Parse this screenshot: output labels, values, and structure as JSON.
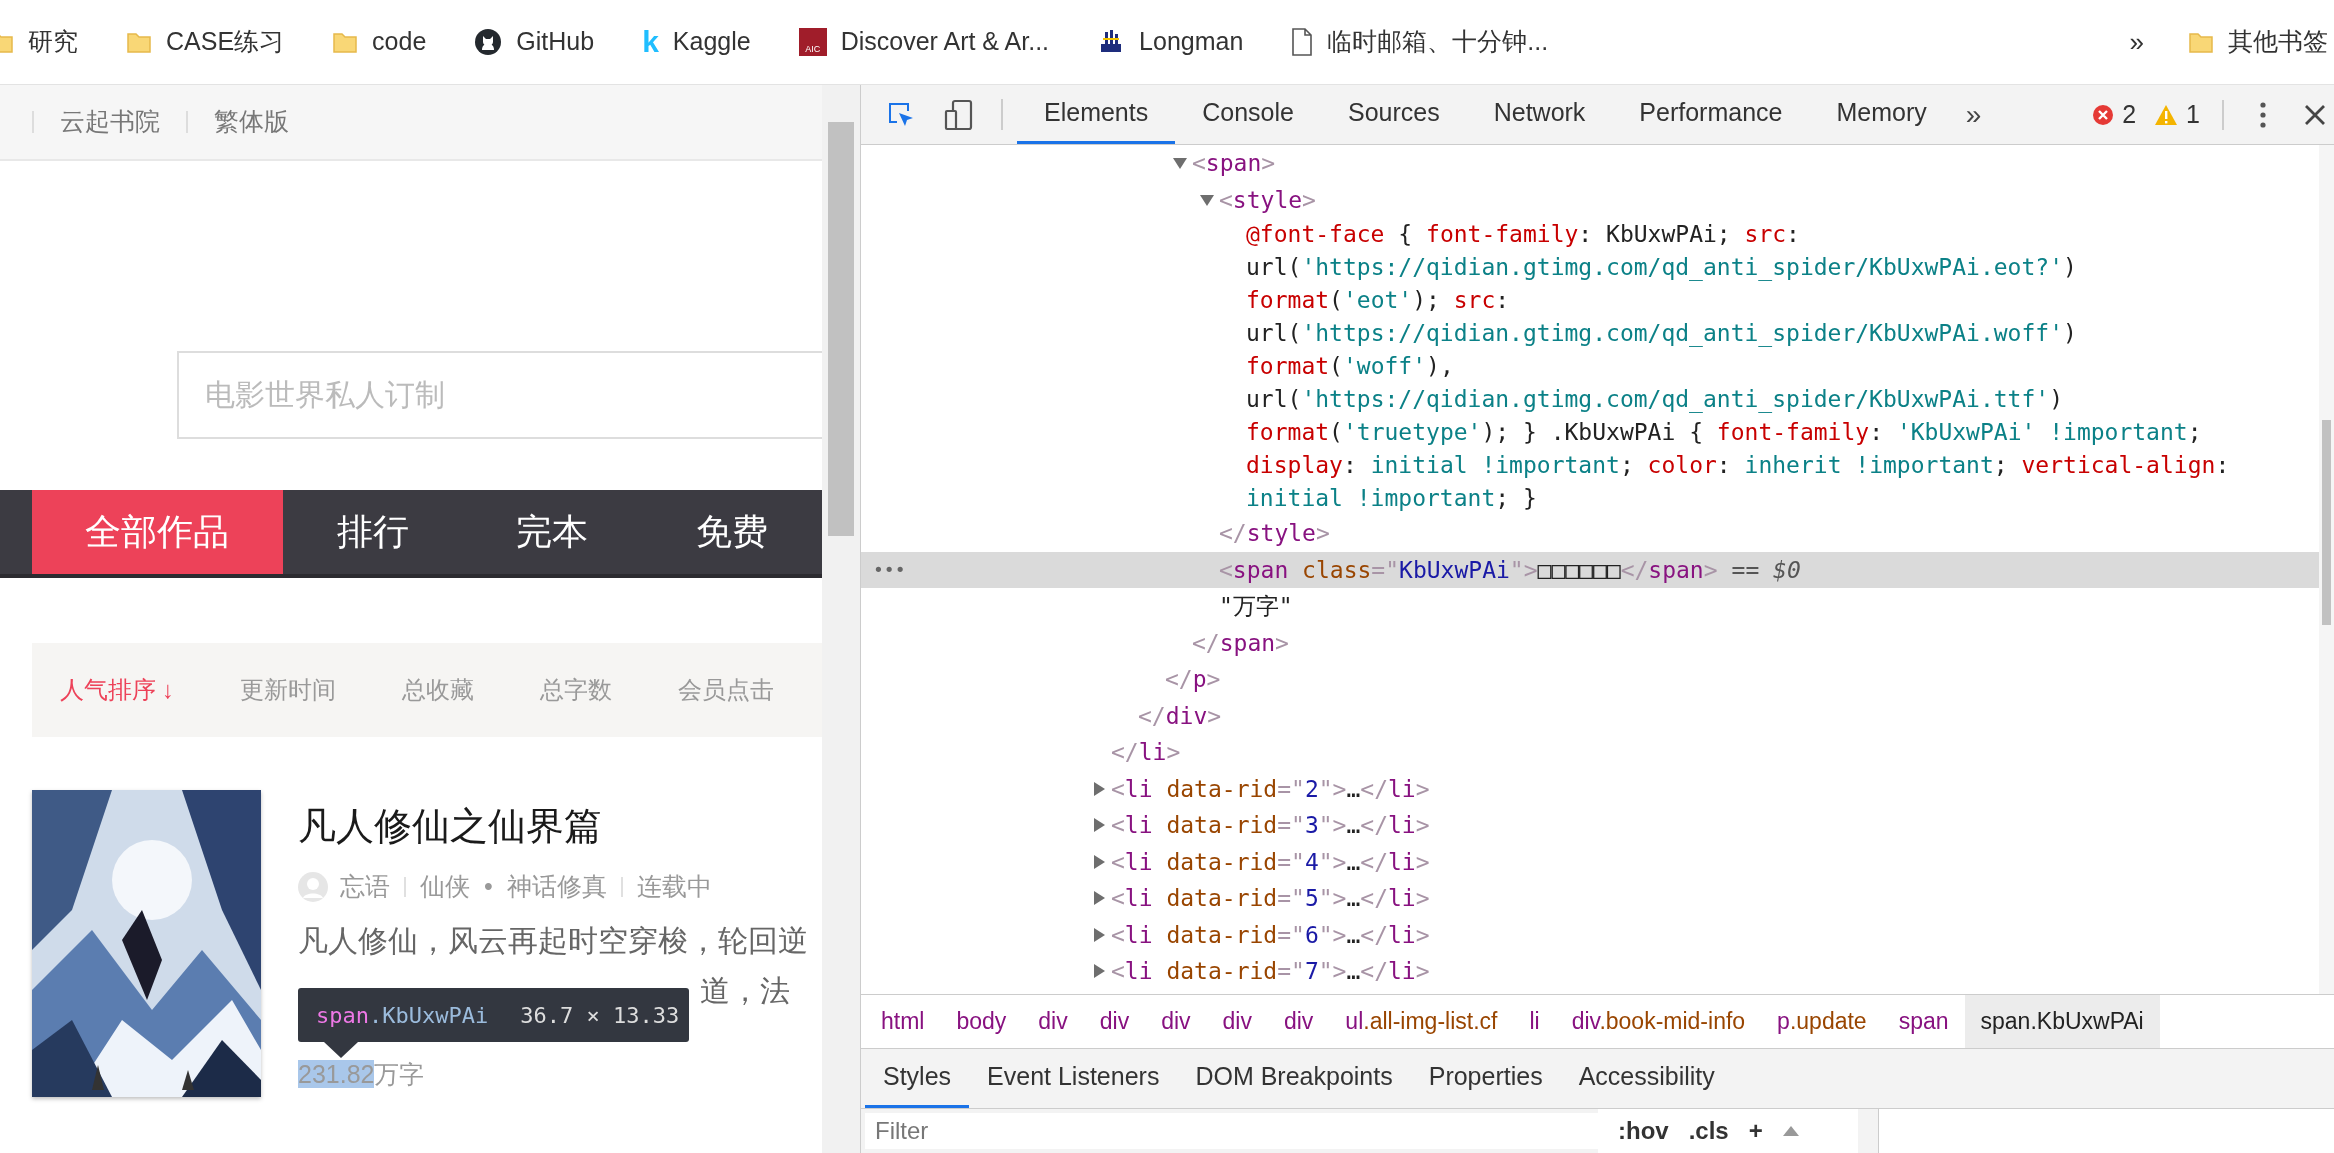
{
  "bookmarks": [
    {
      "kind": "folder",
      "label": "研究"
    },
    {
      "kind": "folder",
      "label": "CASE练习"
    },
    {
      "kind": "folder",
      "label": "code"
    },
    {
      "kind": "cat",
      "label": "GitHub"
    },
    {
      "kind": "letter",
      "glyph": "k",
      "label": "Kaggle"
    },
    {
      "kind": "badge",
      "glyph": "AIC",
      "label": "Discover Art & Ar..."
    },
    {
      "kind": "ship",
      "label": "Longman"
    },
    {
      "kind": "page",
      "label": "临时邮箱、十分钟..."
    }
  ],
  "bookmarks_overflow": "»",
  "other_bookmarks": {
    "kind": "folder",
    "label": "其他书签"
  },
  "site": {
    "top_links": [
      "云起书院",
      "繁体版"
    ],
    "search": {
      "placeholder": "电影世界私人订制"
    },
    "nav_tabs": [
      {
        "label": "全部作品",
        "selected": true
      },
      {
        "label": "排行",
        "selected": false
      },
      {
        "label": "完本",
        "selected": false
      },
      {
        "label": "免费",
        "selected": false
      }
    ],
    "sort_options": [
      {
        "label": "人气排序",
        "arrow": "↓",
        "selected": true
      },
      {
        "label": "更新时间",
        "selected": false
      },
      {
        "label": "总收藏",
        "selected": false
      },
      {
        "label": "总字数",
        "selected": false
      },
      {
        "label": "会员点击",
        "selected": false
      }
    ],
    "book": {
      "cover": {
        "kind": "picture"
      },
      "title": "凡人修仙之仙界篇",
      "meta_groups": [
        [
          "忘语"
        ],
        [
          "仙侠",
          "•",
          "神话修真"
        ],
        [
          "连载中"
        ]
      ],
      "intro_lines": [
        "凡人修仙，风云再起时空穿梭，轮回逆",
        "道，法"
      ],
      "word_count": {
        "highlighted": "231.82",
        "rest": "万字"
      }
    },
    "tooltip": {
      "tag": "span",
      "class": ".KbUxwPAi",
      "size": "36.7 × 13.33"
    }
  },
  "devtools": {
    "tabs": [
      {
        "label": "Elements",
        "selected": true
      },
      {
        "label": "Console",
        "selected": false
      },
      {
        "label": "Sources",
        "selected": false
      },
      {
        "label": "Network",
        "selected": false
      },
      {
        "label": "Performance",
        "selected": false
      },
      {
        "label": "Memory",
        "selected": false
      }
    ],
    "more_tabs": "»",
    "errors": "2",
    "warnings": "1",
    "tree": [
      {
        "close": [
          {
            "kind": "bracket",
            "text": "</"
          },
          {
            "kind": "tag",
            "text": "li"
          },
          {
            "kind": "bracket",
            "text": ">"
          }
        ],
        "children": [
          {
            "close": [
              {
                "kind": "bracket",
                "text": "</"
              },
              {
                "kind": "tag",
                "text": "div"
              },
              {
                "kind": "bracket",
                "text": ">"
              }
            ],
            "children": [
              {
                "close": [
                  {
                    "kind": "bracket",
                    "text": "</"
                  },
                  {
                    "kind": "tag",
                    "text": "p"
                  },
                  {
                    "kind": "bracket",
                    "text": ">"
                  }
                ],
                "children": [
                  {
                    "line": [
                      {
                        "kind": "bracket",
                        "text": "<"
                      },
                      {
                        "kind": "tag",
                        "text": "span"
                      },
                      {
                        "kind": "bracket",
                        "text": ">"
                      }
                    ],
                    "expanded": true,
                    "selected": false,
                    "close": [
                      {
                        "kind": "bracket",
                        "text": "</"
                      },
                      {
                        "kind": "tag",
                        "text": "span"
                      },
                      {
                        "kind": "bracket",
                        "text": ">"
                      }
                    ],
                    "children": [
                      {
                        "line": [
                          {
                            "kind": "bracket",
                            "text": "<"
                          },
                          {
                            "kind": "tag",
                            "text": "style"
                          },
                          {
                            "kind": "bracket",
                            "text": ">"
                          }
                        ],
                        "expanded": true,
                        "selected": false,
                        "close": [
                          {
                            "kind": "bracket",
                            "text": "</"
                          },
                          {
                            "kind": "tag",
                            "text": "style"
                          },
                          {
                            "kind": "bracket",
                            "text": ">"
                          }
                        ],
                        "children": [
                          {
                            "selected": false,
                            "lines": [
                              [
                                {
                                  "kind": "prop",
                                  "text": "@font-face"
                                },
                                {
                                  "kind": "plain",
                                  "text": " { "
                                },
                                {
                                  "kind": "prop",
                                  "text": "font-family"
                                },
                                {
                                  "kind": "plain",
                                  "text": ": KbUxwPAi; "
                                },
                                {
                                  "kind": "prop",
                                  "text": "src"
                                },
                                {
                                  "kind": "plain",
                                  "text": ":"
                                }
                              ],
                              [
                                {
                                  "kind": "plain",
                                  "text": "url("
                                },
                                {
                                  "kind": "cssval",
                                  "text": "'https://qidian.gtimg.com/qd_anti_spider/KbUxwPAi.eot?'"
                                },
                                {
                                  "kind": "plain",
                                  "text": ")"
                                }
                              ],
                              [
                                {
                                  "kind": "prop",
                                  "text": "format"
                                },
                                {
                                  "kind": "plain",
                                  "text": "("
                                },
                                {
                                  "kind": "cssval",
                                  "text": "'eot'"
                                },
                                {
                                  "kind": "plain",
                                  "text": "); "
                                },
                                {
                                  "kind": "prop",
                                  "text": "src"
                                },
                                {
                                  "kind": "plain",
                                  "text": ":"
                                }
                              ],
                              [
                                {
                                  "kind": "plain",
                                  "text": "url("
                                },
                                {
                                  "kind": "cssval",
                                  "text": "'https://qidian.gtimg.com/qd_anti_spider/KbUxwPAi.woff'"
                                },
                                {
                                  "kind": "plain",
                                  "text": ")"
                                }
                              ],
                              [
                                {
                                  "kind": "prop",
                                  "text": "format"
                                },
                                {
                                  "kind": "plain",
                                  "text": "("
                                },
                                {
                                  "kind": "cssval",
                                  "text": "'woff'"
                                },
                                {
                                  "kind": "plain",
                                  "text": "),"
                                }
                              ],
                              [
                                {
                                  "kind": "plain",
                                  "text": "url("
                                },
                                {
                                  "kind": "cssval",
                                  "text": "'https://qidian.gtimg.com/qd_anti_spider/KbUxwPAi.ttf'"
                                },
                                {
                                  "kind": "plain",
                                  "text": ")"
                                }
                              ],
                              [
                                {
                                  "kind": "prop",
                                  "text": "format"
                                },
                                {
                                  "kind": "plain",
                                  "text": "("
                                },
                                {
                                  "kind": "cssval",
                                  "text": "'truetype'"
                                },
                                {
                                  "kind": "plain",
                                  "text": "); } .KbUxwPAi { "
                                },
                                {
                                  "kind": "prop",
                                  "text": "font-family"
                                },
                                {
                                  "kind": "plain",
                                  "text": ": "
                                },
                                {
                                  "kind": "cssval",
                                  "text": "'KbUxwPAi' !important"
                                },
                                {
                                  "kind": "plain",
                                  "text": ";"
                                }
                              ],
                              [
                                {
                                  "kind": "prop",
                                  "text": "display"
                                },
                                {
                                  "kind": "plain",
                                  "text": ": "
                                },
                                {
                                  "kind": "cssval",
                                  "text": "initial !important"
                                },
                                {
                                  "kind": "plain",
                                  "text": "; "
                                },
                                {
                                  "kind": "prop",
                                  "text": "color"
                                },
                                {
                                  "kind": "plain",
                                  "text": ": "
                                },
                                {
                                  "kind": "cssval",
                                  "text": "inherit !important"
                                },
                                {
                                  "kind": "plain",
                                  "text": "; "
                                },
                                {
                                  "kind": "prop",
                                  "text": "vertical-align"
                                },
                                {
                                  "kind": "plain",
                                  "text": ":"
                                }
                              ],
                              [
                                {
                                  "kind": "cssval",
                                  "text": "initial !important"
                                },
                                {
                                  "kind": "plain",
                                  "text": "; }"
                                }
                              ]
                            ]
                          }
                        ]
                      },
                      {
                        "line": [
                          {
                            "kind": "bracket",
                            "text": "<"
                          },
                          {
                            "kind": "tag",
                            "text": "span"
                          },
                          {
                            "kind": "attr",
                            "text": " class"
                          },
                          {
                            "kind": "bracket",
                            "text": "=\""
                          },
                          {
                            "kind": "value",
                            "text": "KbUxwPAi"
                          },
                          {
                            "kind": "bracket",
                            "text": "\">"
                          },
                          {
                            "kind": "plain",
                            "text": "□□□□□□"
                          },
                          {
                            "kind": "bracket",
                            "text": "</"
                          },
                          {
                            "kind": "tag",
                            "text": "span"
                          },
                          {
                            "kind": "bracket",
                            "text": ">"
                          }
                        ],
                        "selected": true,
                        "note": "== $0",
                        "row_menu": "•••"
                      },
                      {
                        "line": [
                          {
                            "kind": "plain",
                            "text": "\"万字\""
                          }
                        ],
                        "selected": false
                      }
                    ]
                  }
                ]
              }
            ]
          }
        ]
      },
      {
        "line": [
          {
            "kind": "bracket",
            "text": "<"
          },
          {
            "kind": "tag",
            "text": "li"
          },
          {
            "kind": "attr",
            "text": " data-rid"
          },
          {
            "kind": "bracket",
            "text": "=\""
          },
          {
            "kind": "value",
            "text": "2"
          },
          {
            "kind": "bracket",
            "text": "\">"
          },
          {
            "kind": "plain",
            "text": "…"
          },
          {
            "kind": "bracket",
            "text": "</"
          },
          {
            "kind": "tag",
            "text": "li"
          },
          {
            "kind": "bracket",
            "text": ">"
          }
        ],
        "expanded": false,
        "selected": false
      },
      {
        "line": [
          {
            "kind": "bracket",
            "text": "<"
          },
          {
            "kind": "tag",
            "text": "li"
          },
          {
            "kind": "attr",
            "text": " data-rid"
          },
          {
            "kind": "bracket",
            "text": "=\""
          },
          {
            "kind": "value",
            "text": "3"
          },
          {
            "kind": "bracket",
            "text": "\">"
          },
          {
            "kind": "plain",
            "text": "…"
          },
          {
            "kind": "bracket",
            "text": "</"
          },
          {
            "kind": "tag",
            "text": "li"
          },
          {
            "kind": "bracket",
            "text": ">"
          }
        ],
        "expanded": false,
        "selected": false
      },
      {
        "line": [
          {
            "kind": "bracket",
            "text": "<"
          },
          {
            "kind": "tag",
            "text": "li"
          },
          {
            "kind": "attr",
            "text": " data-rid"
          },
          {
            "kind": "bracket",
            "text": "=\""
          },
          {
            "kind": "value",
            "text": "4"
          },
          {
            "kind": "bracket",
            "text": "\">"
          },
          {
            "kind": "plain",
            "text": "…"
          },
          {
            "kind": "bracket",
            "text": "</"
          },
          {
            "kind": "tag",
            "text": "li"
          },
          {
            "kind": "bracket",
            "text": ">"
          }
        ],
        "expanded": false,
        "selected": false
      },
      {
        "line": [
          {
            "kind": "bracket",
            "text": "<"
          },
          {
            "kind": "tag",
            "text": "li"
          },
          {
            "kind": "attr",
            "text": " data-rid"
          },
          {
            "kind": "bracket",
            "text": "=\""
          },
          {
            "kind": "value",
            "text": "5"
          },
          {
            "kind": "bracket",
            "text": "\">"
          },
          {
            "kind": "plain",
            "text": "…"
          },
          {
            "kind": "bracket",
            "text": "</"
          },
          {
            "kind": "tag",
            "text": "li"
          },
          {
            "kind": "bracket",
            "text": ">"
          }
        ],
        "expanded": false,
        "selected": false
      },
      {
        "line": [
          {
            "kind": "bracket",
            "text": "<"
          },
          {
            "kind": "tag",
            "text": "li"
          },
          {
            "kind": "attr",
            "text": " data-rid"
          },
          {
            "kind": "bracket",
            "text": "=\""
          },
          {
            "kind": "value",
            "text": "6"
          },
          {
            "kind": "bracket",
            "text": "\">"
          },
          {
            "kind": "plain",
            "text": "…"
          },
          {
            "kind": "bracket",
            "text": "</"
          },
          {
            "kind": "tag",
            "text": "li"
          },
          {
            "kind": "bracket",
            "text": ">"
          }
        ],
        "expanded": false,
        "selected": false
      },
      {
        "line": [
          {
            "kind": "bracket",
            "text": "<"
          },
          {
            "kind": "tag",
            "text": "li"
          },
          {
            "kind": "attr",
            "text": " data-rid"
          },
          {
            "kind": "bracket",
            "text": "=\""
          },
          {
            "kind": "value",
            "text": "7"
          },
          {
            "kind": "bracket",
            "text": "\">"
          },
          {
            "kind": "plain",
            "text": "…"
          },
          {
            "kind": "bracket",
            "text": "</"
          },
          {
            "kind": "tag",
            "text": "li"
          },
          {
            "kind": "bracket",
            "text": ">"
          }
        ],
        "expanded": false,
        "selected": false
      }
    ],
    "breadcrumbs": [
      {
        "tag": "html",
        "selected": false
      },
      {
        "tag": "body",
        "selected": false
      },
      {
        "tag": "div",
        "selected": false
      },
      {
        "tag": "div",
        "selected": false
      },
      {
        "tag": "div",
        "selected": false
      },
      {
        "tag": "div",
        "selected": false
      },
      {
        "tag": "div",
        "selected": false
      },
      {
        "tag": "ul",
        "cls": ".all-img-list.cf",
        "selected": false
      },
      {
        "tag": "li",
        "selected": false
      },
      {
        "tag": "div",
        "cls": ".book-mid-info",
        "selected": false
      },
      {
        "tag": "p",
        "cls": ".update",
        "selected": false
      },
      {
        "tag": "span",
        "selected": false
      },
      {
        "tag": "span",
        "cls": ".KbUxwPAi",
        "selected": true
      }
    ],
    "sub_tabs": [
      {
        "label": "Styles",
        "selected": true
      },
      {
        "label": "Event Listeners",
        "selected": false
      },
      {
        "label": "DOM Breakpoints",
        "selected": false
      },
      {
        "label": "Properties",
        "selected": false
      },
      {
        "label": "Accessibility",
        "selected": false
      }
    ],
    "filter": {
      "placeholder": "Filter"
    },
    "filter_buttons": [
      ":hov",
      ".cls",
      "+"
    ]
  }
}
